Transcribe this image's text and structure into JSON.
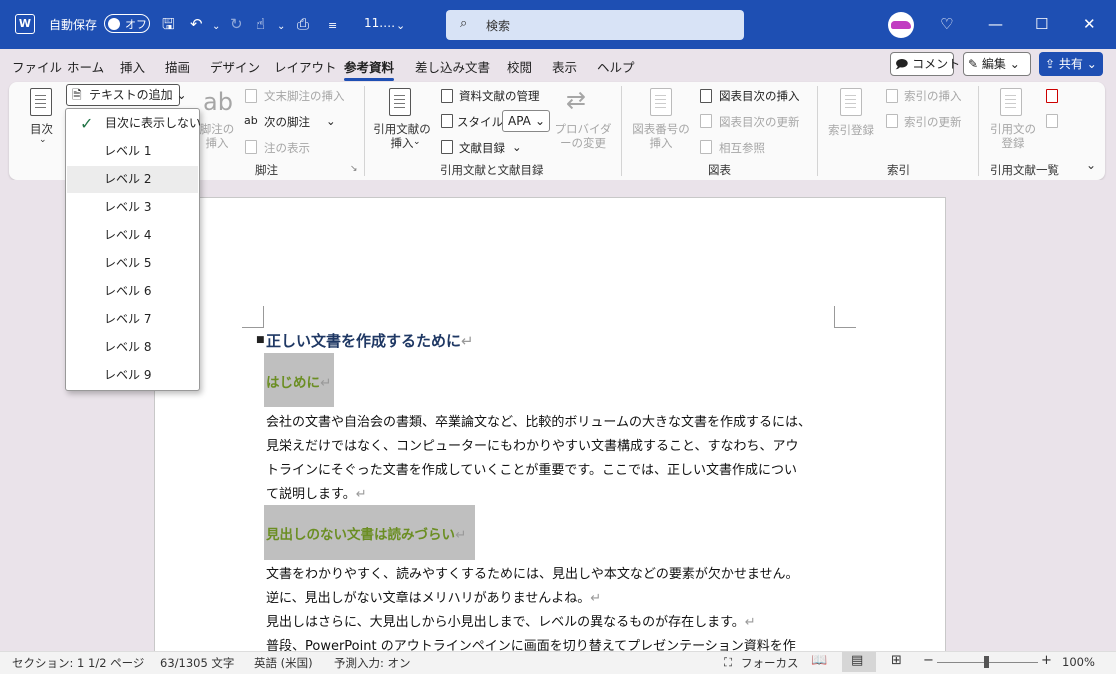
{
  "titlebar": {
    "app_icon": "W",
    "autosave_label": "自動保存",
    "autosave_state": "オフ",
    "filename": "11.…",
    "search_placeholder": "検索"
  },
  "menu": {
    "tabs": [
      "ファイル",
      "ホーム",
      "挿入",
      "描画",
      "デザイン",
      "レイアウト",
      "参考資料",
      "差し込み文書",
      "校閲",
      "表示",
      "ヘルプ"
    ],
    "active": "参考資料",
    "comment_label": "コメント",
    "edit_label": "編集",
    "share_label": "共有"
  },
  "ribbon": {
    "toc_label": "目次",
    "add_text_label": "テキストの追加",
    "footnote_insert": "脚注の挿入",
    "endnote_insert": "文末脚注の挿入",
    "next_footnote": "次の脚注",
    "show_notes": "注の表示",
    "footnote_group": "脚注",
    "citation_insert": "引用文献の挿入",
    "manage_sources": "資料文献の管理",
    "style_label": "スタイル:",
    "style_value": "APA",
    "bibliography": "文献目録",
    "provider_change": "プロバイダーの変更",
    "citation_group": "引用文献と文献目録",
    "caption_insert": "図表番号の挿入",
    "tof_insert": "図表目次の挿入",
    "tof_update": "図表目次の更新",
    "cross_ref": "相互参照",
    "captions_group": "図表",
    "mark_entry": "索引登録",
    "index_insert": "索引の挿入",
    "index_update": "索引の更新",
    "index_group": "索引",
    "mark_citation": "引用文の登録",
    "toa_group": "引用文献一覧"
  },
  "dropdown": {
    "items": [
      "目次に表示しない",
      "レベル 1",
      "レベル 2",
      "レベル 3",
      "レベル 4",
      "レベル 5",
      "レベル 6",
      "レベル 7",
      "レベル 8",
      "レベル 9"
    ],
    "checked_index": 0,
    "hover_index": 2
  },
  "document": {
    "heading1": "正しい文書を作成するために",
    "heading2a": "はじめに",
    "para1": [
      "会社の文書や自治会の書類、卒業論文など、比較的ボリュームの大きな文書を作成するには、",
      "見栄えだけではなく、コンピューターにもわかりやすい文書構成すること、すなわち、アウ",
      "トラインにそぐった文書を作成していくことが重要です。ここでは、正しい文書作成につい",
      "て説明します。"
    ],
    "heading2b": "見出しのない文書は読みづらい",
    "para2": [
      "文書をわかりやすく、読みやすくするためには、見出しや本文などの要素が欠かせません。",
      "逆に、見出しがない文章はメリハリがありませんよね。",
      "見出しはさらに、大見出しから小見出しまで、レベルの異なるものが存在します。",
      "普段、PowerPoint のアウトラインペインに画面を切り替えてプレゼンテーション資料を作"
    ],
    "return_mark": "↵"
  },
  "statusbar": {
    "section": "セクション: 1",
    "page": "1/2 ページ",
    "words": "63/1305 文字",
    "language": "英語 (米国)",
    "predict": "予測入力: オン",
    "focus": "フォーカス",
    "zoom_minus": "−",
    "zoom_plus": "+",
    "zoom": "100%",
    "zoom_level_percent": 100
  }
}
